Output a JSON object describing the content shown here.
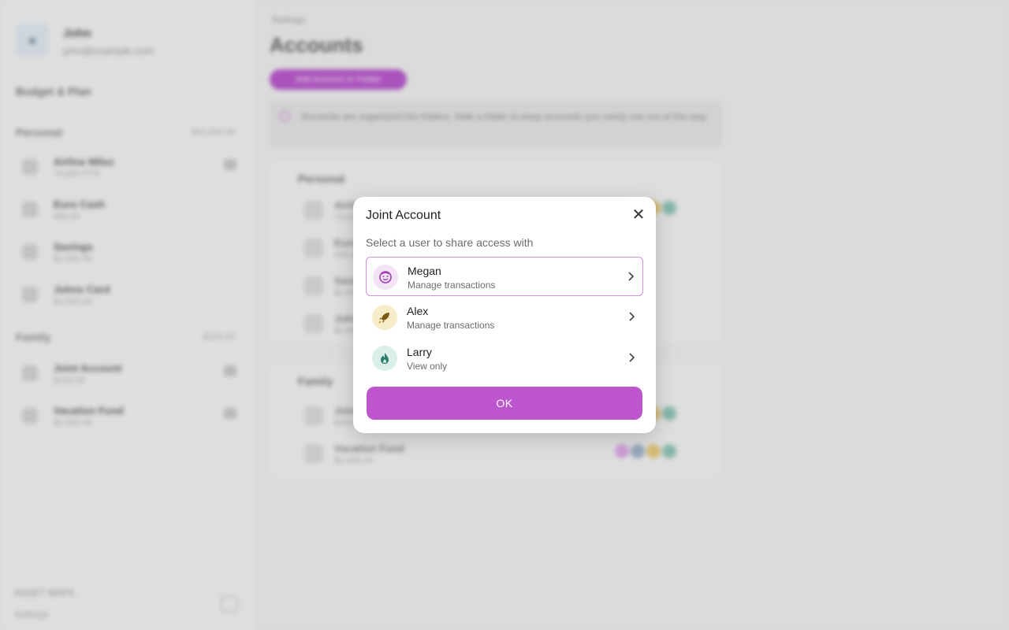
{
  "background": {
    "sidebar": {
      "user_name": "John",
      "user_email": "john@example.com",
      "budget_title": "Budget & Plan",
      "groups": [
        {
          "title": "Personal",
          "total": "$10,000.00",
          "items": [
            {
              "name": "Airline Miles",
              "balance": "74,000 PTS"
            },
            {
              "name": "Euro Cash",
              "balance": "€80.00"
            },
            {
              "name": "Savings",
              "balance": "$1,000.00"
            },
            {
              "name": "Johns Card",
              "balance": "$1,000.00"
            }
          ]
        },
        {
          "title": "Family",
          "total": "$100.00",
          "items": [
            {
              "name": "Joint Account",
              "balance": "$100.00"
            },
            {
              "name": "Vacation Fund",
              "balance": "$1,000.00"
            }
          ]
        }
      ],
      "footer_label": "ASSET MAPS",
      "footer_sub": "Settings"
    },
    "main": {
      "breadcrumb": "Settings",
      "title": "Accounts",
      "add_button": "Add Account or Folder",
      "info_text": "Accounts are organized into folders. Hide a folder to keep accounts you rarely use out of the way.",
      "cards": [
        {
          "title": "Personal",
          "rows": [
            {
              "name": "Airline Miles",
              "balance": "74,000 PTS"
            },
            {
              "name": "Euro Cash",
              "balance": "€80.00"
            },
            {
              "name": "Savings",
              "balance": "$1,000.00"
            },
            {
              "name": "Johns Card",
              "balance": "$1,000.00"
            }
          ]
        },
        {
          "title": "Family",
          "rows": [
            {
              "name": "Joint Account",
              "balance": "$100.00"
            },
            {
              "name": "Vacation Fund",
              "balance": "$1,000.00"
            }
          ]
        }
      ]
    }
  },
  "modal": {
    "title": "Joint Account",
    "subtitle": "Select a user to share access with",
    "close_icon": "close-icon",
    "users": [
      {
        "name": "Megan",
        "role": "Manage transactions",
        "icon": "smiley-icon",
        "avatar_bg": "#f2e3f5",
        "icon_color": "#a13fb3",
        "selected": true
      },
      {
        "name": "Alex",
        "role": "Manage transactions",
        "icon": "rocket-icon",
        "avatar_bg": "#f7edc9",
        "icon_color": "#7b5a12",
        "selected": false
      },
      {
        "name": "Larry",
        "role": "View only",
        "icon": "flame-icon",
        "avatar_bg": "#dbefe9",
        "icon_color": "#2f7d6f",
        "selected": false
      }
    ],
    "ok_label": "OK",
    "accent_color": "#bd55cf"
  }
}
